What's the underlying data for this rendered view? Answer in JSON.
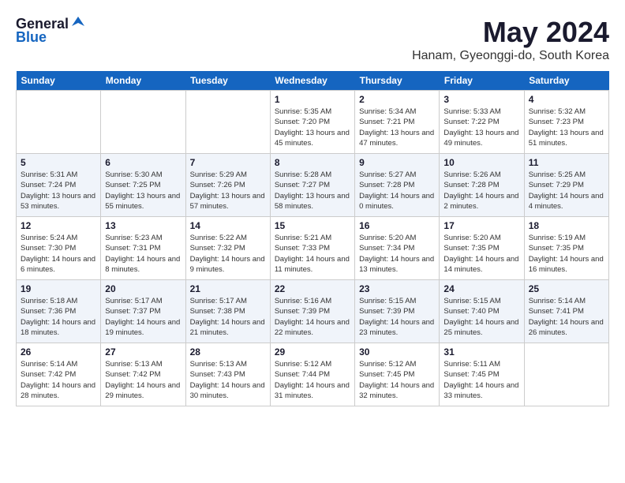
{
  "header": {
    "logo_general": "General",
    "logo_blue": "Blue",
    "title": "May 2024",
    "location": "Hanam, Gyeonggi-do, South Korea"
  },
  "days_of_week": [
    "Sunday",
    "Monday",
    "Tuesday",
    "Wednesday",
    "Thursday",
    "Friday",
    "Saturday"
  ],
  "weeks": [
    [
      null,
      null,
      null,
      {
        "day": 1,
        "sunrise": "5:35 AM",
        "sunset": "7:20 PM",
        "daylight": "13 hours and 45 minutes."
      },
      {
        "day": 2,
        "sunrise": "5:34 AM",
        "sunset": "7:21 PM",
        "daylight": "13 hours and 47 minutes."
      },
      {
        "day": 3,
        "sunrise": "5:33 AM",
        "sunset": "7:22 PM",
        "daylight": "13 hours and 49 minutes."
      },
      {
        "day": 4,
        "sunrise": "5:32 AM",
        "sunset": "7:23 PM",
        "daylight": "13 hours and 51 minutes."
      }
    ],
    [
      {
        "day": 5,
        "sunrise": "5:31 AM",
        "sunset": "7:24 PM",
        "daylight": "13 hours and 53 minutes."
      },
      {
        "day": 6,
        "sunrise": "5:30 AM",
        "sunset": "7:25 PM",
        "daylight": "13 hours and 55 minutes."
      },
      {
        "day": 7,
        "sunrise": "5:29 AM",
        "sunset": "7:26 PM",
        "daylight": "13 hours and 57 minutes."
      },
      {
        "day": 8,
        "sunrise": "5:28 AM",
        "sunset": "7:27 PM",
        "daylight": "13 hours and 58 minutes."
      },
      {
        "day": 9,
        "sunrise": "5:27 AM",
        "sunset": "7:28 PM",
        "daylight": "14 hours and 0 minutes."
      },
      {
        "day": 10,
        "sunrise": "5:26 AM",
        "sunset": "7:28 PM",
        "daylight": "14 hours and 2 minutes."
      },
      {
        "day": 11,
        "sunrise": "5:25 AM",
        "sunset": "7:29 PM",
        "daylight": "14 hours and 4 minutes."
      }
    ],
    [
      {
        "day": 12,
        "sunrise": "5:24 AM",
        "sunset": "7:30 PM",
        "daylight": "14 hours and 6 minutes."
      },
      {
        "day": 13,
        "sunrise": "5:23 AM",
        "sunset": "7:31 PM",
        "daylight": "14 hours and 8 minutes."
      },
      {
        "day": 14,
        "sunrise": "5:22 AM",
        "sunset": "7:32 PM",
        "daylight": "14 hours and 9 minutes."
      },
      {
        "day": 15,
        "sunrise": "5:21 AM",
        "sunset": "7:33 PM",
        "daylight": "14 hours and 11 minutes."
      },
      {
        "day": 16,
        "sunrise": "5:20 AM",
        "sunset": "7:34 PM",
        "daylight": "14 hours and 13 minutes."
      },
      {
        "day": 17,
        "sunrise": "5:20 AM",
        "sunset": "7:35 PM",
        "daylight": "14 hours and 14 minutes."
      },
      {
        "day": 18,
        "sunrise": "5:19 AM",
        "sunset": "7:35 PM",
        "daylight": "14 hours and 16 minutes."
      }
    ],
    [
      {
        "day": 19,
        "sunrise": "5:18 AM",
        "sunset": "7:36 PM",
        "daylight": "14 hours and 18 minutes."
      },
      {
        "day": 20,
        "sunrise": "5:17 AM",
        "sunset": "7:37 PM",
        "daylight": "14 hours and 19 minutes."
      },
      {
        "day": 21,
        "sunrise": "5:17 AM",
        "sunset": "7:38 PM",
        "daylight": "14 hours and 21 minutes."
      },
      {
        "day": 22,
        "sunrise": "5:16 AM",
        "sunset": "7:39 PM",
        "daylight": "14 hours and 22 minutes."
      },
      {
        "day": 23,
        "sunrise": "5:15 AM",
        "sunset": "7:39 PM",
        "daylight": "14 hours and 23 minutes."
      },
      {
        "day": 24,
        "sunrise": "5:15 AM",
        "sunset": "7:40 PM",
        "daylight": "14 hours and 25 minutes."
      },
      {
        "day": 25,
        "sunrise": "5:14 AM",
        "sunset": "7:41 PM",
        "daylight": "14 hours and 26 minutes."
      }
    ],
    [
      {
        "day": 26,
        "sunrise": "5:14 AM",
        "sunset": "7:42 PM",
        "daylight": "14 hours and 28 minutes."
      },
      {
        "day": 27,
        "sunrise": "5:13 AM",
        "sunset": "7:42 PM",
        "daylight": "14 hours and 29 minutes."
      },
      {
        "day": 28,
        "sunrise": "5:13 AM",
        "sunset": "7:43 PM",
        "daylight": "14 hours and 30 minutes."
      },
      {
        "day": 29,
        "sunrise": "5:12 AM",
        "sunset": "7:44 PM",
        "daylight": "14 hours and 31 minutes."
      },
      {
        "day": 30,
        "sunrise": "5:12 AM",
        "sunset": "7:45 PM",
        "daylight": "14 hours and 32 minutes."
      },
      {
        "day": 31,
        "sunrise": "5:11 AM",
        "sunset": "7:45 PM",
        "daylight": "14 hours and 33 minutes."
      },
      null
    ]
  ]
}
